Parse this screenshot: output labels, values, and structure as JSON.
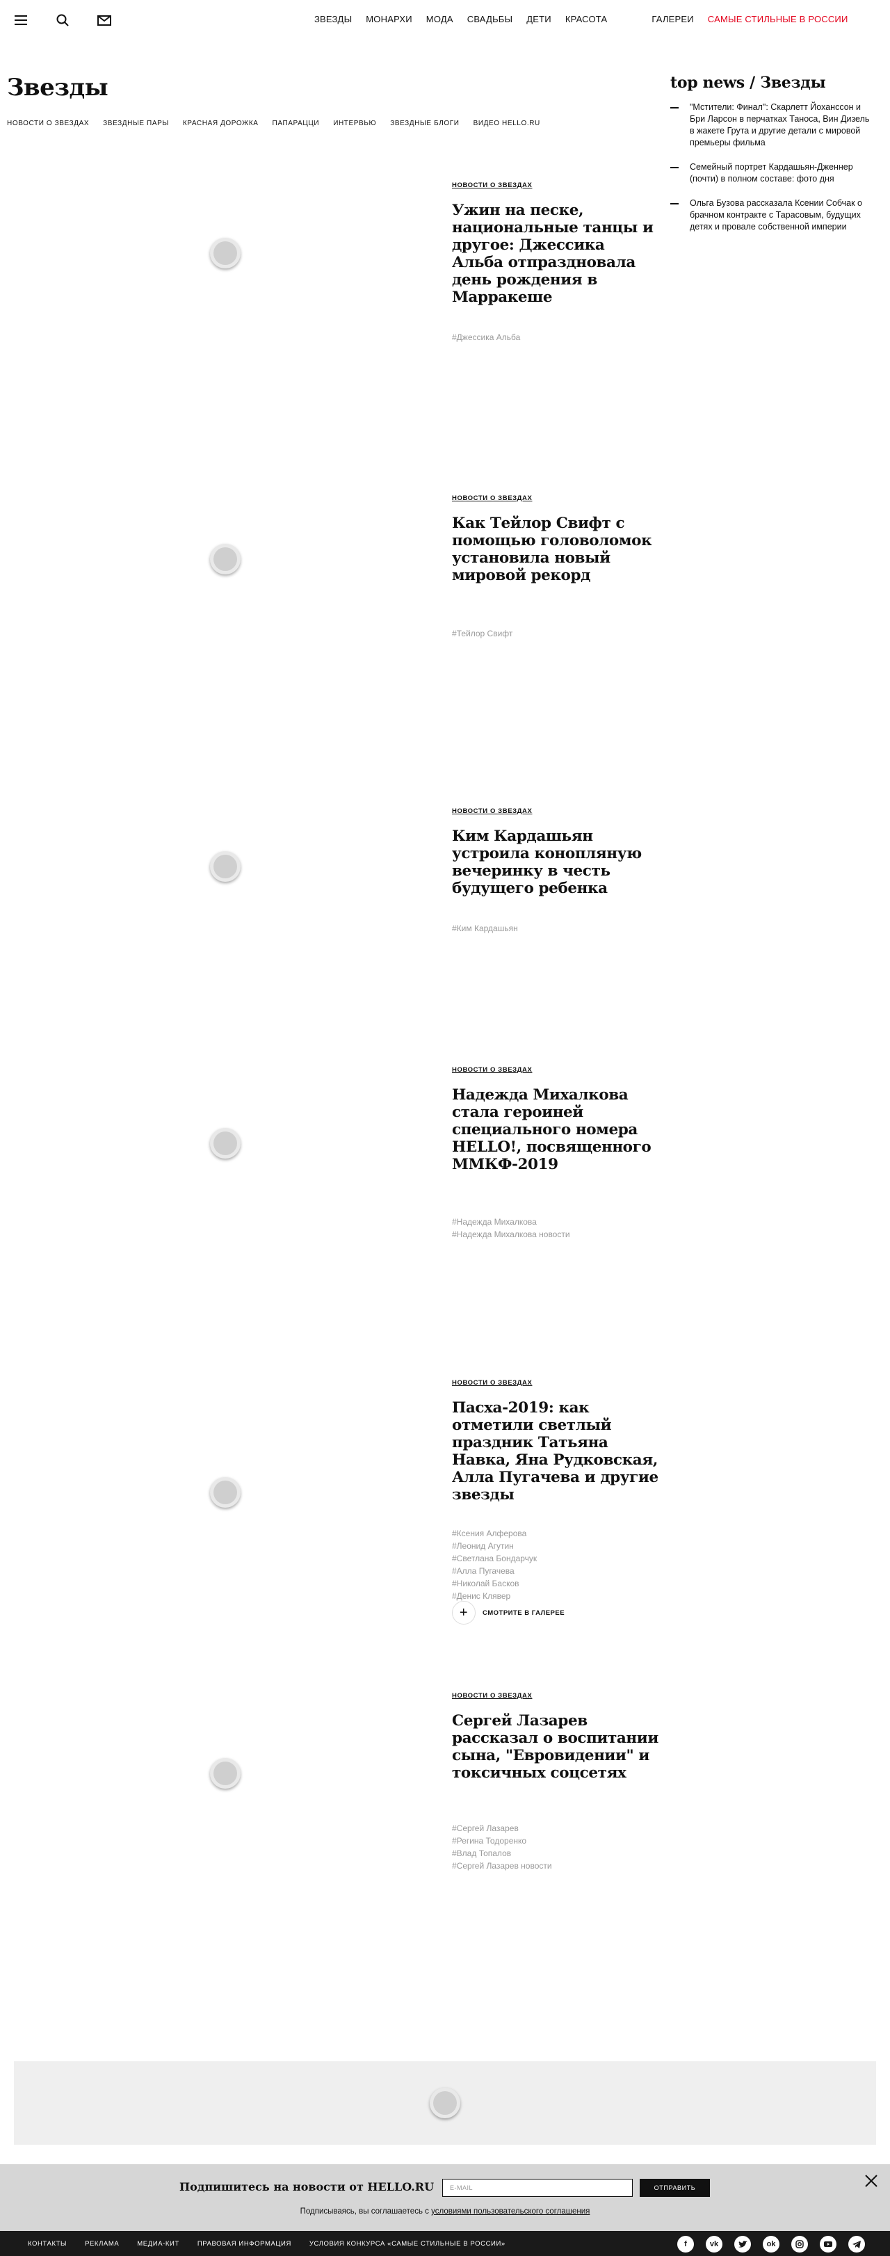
{
  "header": {
    "nav": [
      "ЗВЕЗДЫ",
      "МОНАРХИ",
      "МОДА",
      "СВАДЬБЫ",
      "ДЕТИ",
      "КРАСОТА"
    ],
    "nav_extra": [
      "ГАЛЕРЕИ",
      "САМЫЕ СТИЛЬНЫЕ В РОССИИ"
    ],
    "accent_color": "#e3001b"
  },
  "page": {
    "title": "Звезды",
    "subnav": [
      "НОВОСТИ О ЗВЕЗДАХ",
      "ЗВЕЗДНЫЕ ПАРЫ",
      "КРАСНАЯ ДОРОЖКА",
      "ПАПАРАЦЦИ",
      "ИНТЕРВЬЮ",
      "ЗВЕЗДНЫЕ БЛОГИ",
      "ВИДЕО HELLO.RU"
    ]
  },
  "sidebar": {
    "title": "top news / Звезды",
    "items": [
      "\"Мстители: Финал\": Скарлетт Йоханссон и Бри Ларсон в перчатках Таноса, Вин Дизель в жакете Грута и другие детали с мировой премьеры фильма",
      "Семейный портрет Кардашьян-Дженнер (почти) в полном составе: фото дня",
      "Ольга Бузова рассказала Ксении Собчак о брачном контракте с Тарасовым, будущих детях и провале собственной империи"
    ]
  },
  "articles": [
    {
      "category": "НОВОСТИ О ЗВЕЗДАХ",
      "headline": "Ужин на песке, национальные танцы и другое: Джессика Альба отпраздновала день рождения в Марракеше",
      "tags": [
        "#Джессика Альба"
      ]
    },
    {
      "category": "НОВОСТИ О ЗВЕЗДАХ",
      "headline": "Как Тейлор Свифт с помощью головоломок установила новый мировой рекорд",
      "tags": [
        "#Тейлор Свифт"
      ]
    },
    {
      "category": "НОВОСТИ О ЗВЕЗДАХ",
      "headline": "Ким Кардашьян устроила конопляную вечеринку в честь будущего ребенка",
      "tags": [
        "#Ким Кардашьян"
      ]
    },
    {
      "category": "НОВОСТИ О ЗВЕЗДАХ",
      "headline": "Надежда Михалкова стала героиней специального номера HELLO!, посвященного ММКФ-2019",
      "tags": [
        "#Надежда Михалкова",
        "#Надежда Михалкова новости"
      ]
    },
    {
      "category": "НОВОСТИ О ЗВЕЗДАХ",
      "headline": "Пасха-2019: как отметили светлый праздник Татьяна Навка, Яна Рудковская, Алла Пугачева и другие звезды",
      "tags": [
        "#Ксения Алферова",
        "#Леонид Агутин",
        "#Светлана Бондарчук",
        "#Алла Пугачева",
        "#Николай Басков",
        "#Денис Клявер"
      ],
      "gallery_label": "СМОТРИТЕ В ГАЛЕРЕЕ"
    },
    {
      "category": "НОВОСТИ О ЗВЕЗДАХ",
      "headline": "Сергей Лазарев рассказал о воспитании сына, \"Евровидении\" и токсичных соцсетях",
      "tags": [
        "#Сергей Лазарев",
        "#Регина Тодоренко",
        "#Влад Топалов",
        "#Сергей Лазарев новости"
      ]
    }
  ],
  "subscribe": {
    "heading": "Подпишитесь на новости от HELLO.RU",
    "email_placeholder": "E-MAIL",
    "send_label": "ОТПРАВИТЬ",
    "note_prefix": "Подписываясь, вы соглашаетесь с",
    "note_link": "условиями пользовательского соглашения"
  },
  "footer": {
    "links": [
      "КОНТАКТЫ",
      "РЕКЛАМА",
      "МЕДИА-КИТ",
      "ПРАВОВАЯ ИНФОРМАЦИЯ",
      "УСЛОВИЯ КОНКУРСА «САМЫЕ СТИЛЬНЫЕ В РОССИИ»"
    ],
    "social": [
      "facebook-icon",
      "vk-icon",
      "twitter-icon",
      "odnoklassniki-icon",
      "instagram-icon",
      "youtube-icon",
      "telegram-icon"
    ]
  }
}
